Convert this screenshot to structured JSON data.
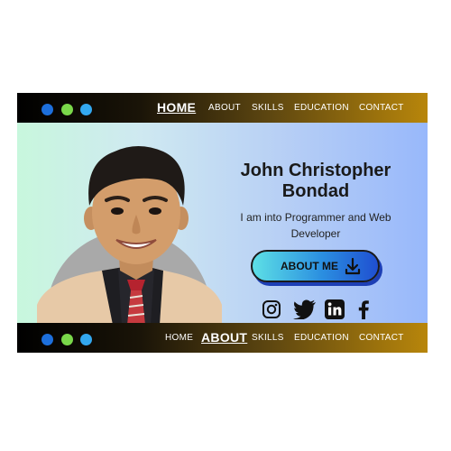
{
  "nav_top": {
    "items": [
      {
        "label": "HOME",
        "active": true
      },
      {
        "label": "ABOUT",
        "active": false
      },
      {
        "label": "SKILLS",
        "active": false
      },
      {
        "label": "EDUCATION",
        "active": false
      },
      {
        "label": "CONTACT",
        "active": false
      }
    ]
  },
  "nav_bottom": {
    "items": [
      {
        "label": "HOME",
        "active": false
      },
      {
        "label": "ABOUT",
        "active": true
      },
      {
        "label": "SKILLS",
        "active": false
      },
      {
        "label": "EDUCATION",
        "active": false
      },
      {
        "label": "CONTACT",
        "active": false
      }
    ]
  },
  "window_dots": [
    "#1d6fdc",
    "#7ad84a",
    "#33a8f0"
  ],
  "hero": {
    "name": "John Christopher Bondad",
    "tagline": "I am into Programmer and Web Developer",
    "button_label": "ABOUT ME",
    "button_icon": "download-icon"
  },
  "social_icons": [
    "instagram-icon",
    "twitter-icon",
    "linkedin-icon",
    "facebook-icon"
  ],
  "colors": {
    "nav_gold": "#b8860b",
    "button_blue": "#2b8fe0",
    "hero_left": "#c8f7dd",
    "hero_right": "#98b8fb"
  }
}
